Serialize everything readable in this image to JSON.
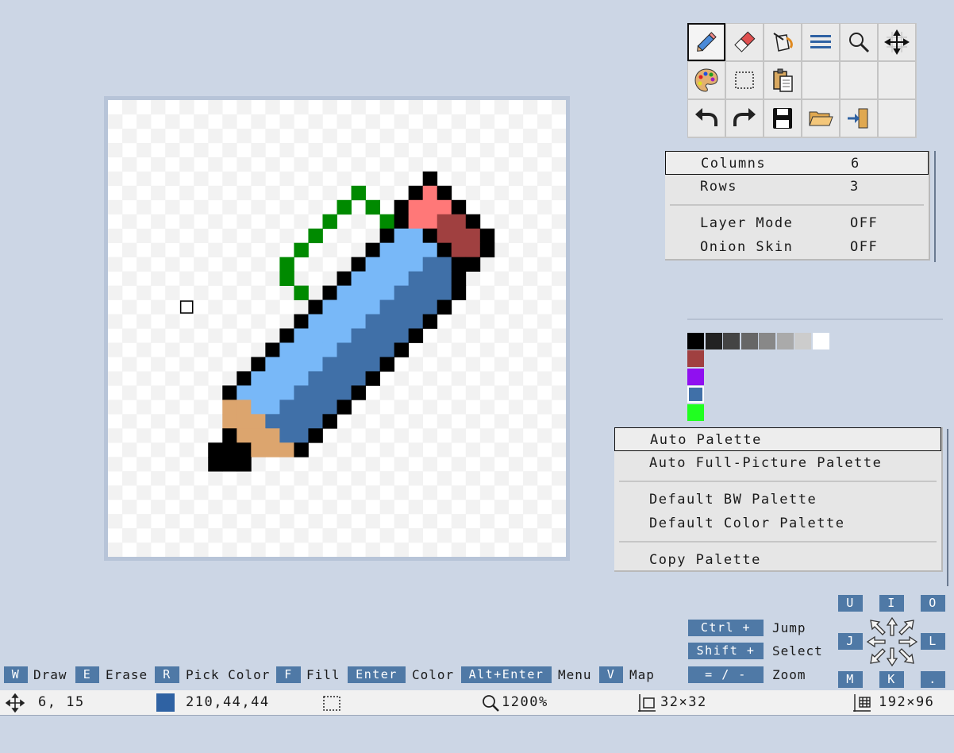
{
  "toolbar": {
    "tools": [
      {
        "icon": "pencil-icon",
        "name": "tool-draw",
        "active": true
      },
      {
        "icon": "eraser-icon",
        "name": "tool-erase"
      },
      {
        "icon": "paint-bucket-icon",
        "name": "tool-fill"
      },
      {
        "icon": "menu-lines-icon",
        "name": "tool-menu"
      },
      {
        "icon": "magnifier-icon",
        "name": "tool-zoom"
      },
      {
        "icon": "move-grid-icon",
        "name": "tool-move"
      },
      {
        "icon": "palette-icon",
        "name": "tool-palette"
      },
      {
        "icon": "selection-icon",
        "name": "tool-select"
      },
      {
        "icon": "clipboard-icon",
        "name": "tool-paste"
      },
      {
        "icon": "",
        "name": "tool-empty"
      },
      {
        "icon": "",
        "name": "tool-empty"
      },
      {
        "icon": "",
        "name": "tool-empty"
      },
      {
        "icon": "undo-icon",
        "name": "tool-undo"
      },
      {
        "icon": "redo-icon",
        "name": "tool-redo"
      },
      {
        "icon": "save-icon",
        "name": "tool-save"
      },
      {
        "icon": "folder-open-icon",
        "name": "tool-open"
      },
      {
        "icon": "exit-icon",
        "name": "tool-exit"
      },
      {
        "icon": "",
        "name": "tool-empty"
      }
    ]
  },
  "grid_menu": {
    "columns_label": "Columns",
    "columns_value": "6",
    "rows_label": "Rows",
    "rows_value": "3",
    "layer_mode_label": "Layer Mode",
    "layer_mode_value": "OFF",
    "onion_skin_label": "Onion Skin",
    "onion_skin_value": "OFF"
  },
  "palette_menu": {
    "auto_palette": "Auto Palette",
    "auto_full": "Auto Full-Picture Palette",
    "default_bw": "Default BW Palette",
    "default_color": "Default Color Palette",
    "copy_palette": "Copy Palette"
  },
  "colors": {
    "background": "#ccd6e5",
    "accent": "#4f79a6",
    "active_color": "#2f62a3"
  },
  "palette": {
    "row1": [
      "#000000",
      "#222222",
      "#444444",
      "#666666",
      "#888888",
      "#aaaaaa",
      "#cccccc",
      "#ffffff"
    ],
    "column": [
      "#a04040",
      "#9010f0",
      "#4070a8",
      "#20ff20"
    ]
  },
  "shortcuts": [
    {
      "key": "W",
      "label": "Draw"
    },
    {
      "key": "E",
      "label": "Erase"
    },
    {
      "key": "R",
      "label": "Pick Color"
    },
    {
      "key": "F",
      "label": "Fill"
    },
    {
      "key": "Enter",
      "label": "Color"
    },
    {
      "key": "Alt+Enter",
      "label": "Menu"
    },
    {
      "key": "V",
      "label": "Map"
    }
  ],
  "modifiers": [
    {
      "key": "Ctrl +",
      "label": "Jump"
    },
    {
      "key": "Shift +",
      "label": "Select"
    },
    {
      "key": "= / -",
      "label": "Zoom"
    }
  ],
  "nav_keys": {
    "u": "U",
    "i": "I",
    "o": "O",
    "j": "J",
    "l": "L",
    "m": "M",
    "k": "K",
    "dot": "."
  },
  "status": {
    "cursor": "6, 15",
    "color_value": "210,44,44",
    "zoom": "1200%",
    "canvas_size": "32×32",
    "sheet_size": "192×96"
  },
  "pixel_art": {
    "size": 32,
    "rows": [
      "................................",
      "................................",
      "................................",
      "................................",
      "................................",
      "......................K.........",
      ".................G...KRK........",
      "................G.G.KRRRK.......",
      "...............G...GKRRDDK......",
      "..............G....KBBKDDDK.....",
      ".............G....KBBBBKDDK.....",
      "............G....KBBBBHHKK......",
      "............G...KBBBBHHHK.......",
      ".............G.KBBBBHHHHK.......",
      "..............KBBBBHHHHK........",
      ".............KBBBBHHHHK.........",
      "............KBBBBHHHHK..........",
      "...........KBBBBHHHHK...........",
      "..........KBBBBHHHHK............",
      ".........KBBBBHHHHK.............",
      "........KBBBBHHHHK..............",
      "........TTBBHHHHK...............",
      "........TTTHHHHK................",
      "........KTTTHHK.................",
      ".......KKKTTTK..................",
      ".......KKK......................",
      "................................",
      "................................",
      "................................",
      "................................",
      "................................",
      "................................"
    ],
    "colors": {
      "K": "#000000",
      "R": "#ff7878",
      "D": "#a04040",
      "B": "#78b8f8",
      "H": "#4070a8",
      "T": "#dca56e",
      "G": "#008a00"
    },
    "cursor_cell": [
      5,
      14
    ]
  }
}
